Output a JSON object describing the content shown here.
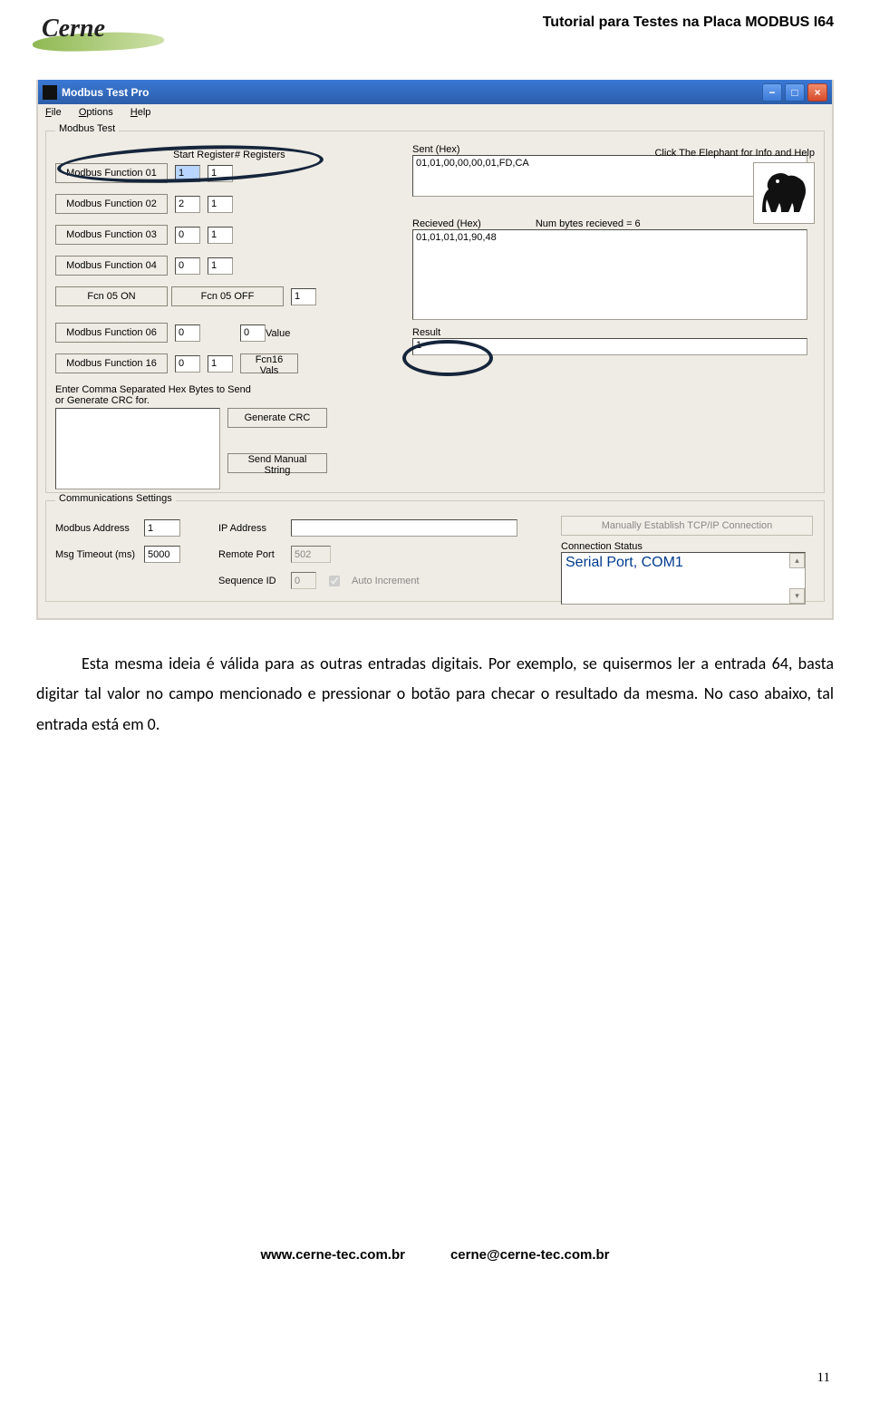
{
  "header": {
    "logo_text": "Cerne",
    "page_title": "Tutorial para Testes na Placa MODBUS I64"
  },
  "app": {
    "title": "Modbus Test Pro",
    "menu": {
      "file": "File",
      "options": "Options",
      "help": "Help"
    },
    "modbus_test": {
      "legend": "Modbus Test",
      "start_reg": "Start Register",
      "num_reg": "# Registers",
      "fn01": "Modbus Function 01",
      "fn01_sr": "1",
      "fn01_nr": "1",
      "fn02": "Modbus Function 02",
      "fn02_sr": "2",
      "fn02_nr": "1",
      "fn03": "Modbus Function 03",
      "fn03_sr": "0",
      "fn03_nr": "1",
      "fn04": "Modbus Function 04",
      "fn04_sr": "0",
      "fn04_nr": "1",
      "fn05on": "Fcn 05 ON",
      "fn05off": "Fcn 05 OFF",
      "fn05_sr": "1",
      "value_lbl": "Value",
      "fn06": "Modbus Function 06",
      "fn06_sr": "0",
      "fn06_val": "0",
      "fn16": "Modbus Function 16",
      "fn16_sr": "0",
      "fn16_nr": "1",
      "fn16_vals": "Fcn16 Vals",
      "manual_lbl_l1": "Enter Comma Separated Hex Bytes to Send",
      "manual_lbl_l2": "or Generate CRC for.",
      "gen_crc": "Generate CRC",
      "send_manual": "Send Manual String",
      "sent_lbl": "Sent (Hex)",
      "sent_val": "01,01,00,00,00,01,FD,CA",
      "recv_lbl": "Recieved (Hex)",
      "numbytes_lbl": "Num bytes recieved = 6",
      "recv_val": "01,01,01,01,90,48",
      "result_lbl": "Result",
      "result_val": "1",
      "elephant_lbl": "Click The Elephant for Info and Help"
    },
    "comm": {
      "legend": "Communications Settings",
      "modbus_addr_lbl": "Modbus Address",
      "modbus_addr_val": "1",
      "msg_to_lbl": "Msg Timeout (ms)",
      "msg_to_val": "5000",
      "ip_lbl": "IP Address",
      "ip_val": "",
      "remote_port_lbl": "Remote Port",
      "remote_port_val": "502",
      "seq_lbl": "Sequence ID",
      "seq_val": "0",
      "auto_inc": "Auto Increment",
      "tcp_btn": "Manually Establish TCP/IP Connection",
      "conn_status_lbl": "Connection Status",
      "conn_status_val": "Serial Port, COM1"
    }
  },
  "body_text": "Esta mesma ideia é válida para as outras entradas digitais. Por exemplo, se quisermos ler a entrada 64, basta digitar tal valor no campo mencionado e pressionar o botão para checar o resultado da mesma. No caso abaixo, tal entrada está em 0.",
  "footer": {
    "url": "www.cerne-tec.com.br",
    "email": "cerne@cerne-tec.com.br",
    "page": "11"
  }
}
